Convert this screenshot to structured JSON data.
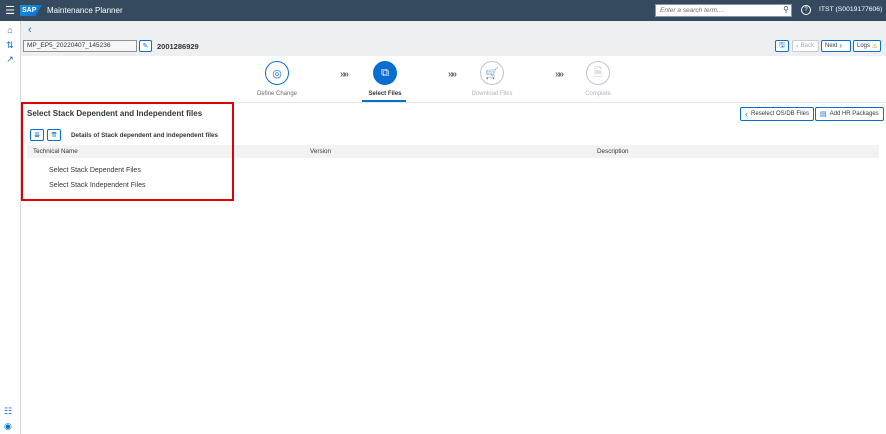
{
  "shell": {
    "logo": "SAP",
    "app_title": "Maintenance Planner",
    "search_placeholder": "Enter a search term....",
    "user": "ITST (S0019177606)",
    "icons": [
      "menu-icon",
      "search-icon",
      "help-icon"
    ]
  },
  "rail": {
    "icons": [
      "home-icon",
      "sort-icon",
      "external-link-icon",
      "library-icon",
      "location-icon"
    ]
  },
  "header": {
    "plan_name": "MP_EP5_20220407_145236",
    "plan_number": "2001286929",
    "buttons": {
      "back": "Back",
      "next": "Next",
      "logs": "Logs"
    }
  },
  "wizard": {
    "steps": [
      {
        "label": "Define Change",
        "state": "done",
        "icon": "target-icon"
      },
      {
        "label": "Select Files",
        "state": "active",
        "icon": "files-icon"
      },
      {
        "label": "Download Files",
        "state": "pending",
        "icon": "cart-icon"
      },
      {
        "label": "Complete",
        "state": "pending",
        "icon": "document-icon"
      }
    ]
  },
  "actions": {
    "reselect": "Reselect OS/DB Files",
    "add_hr": "Add HR Packages"
  },
  "section": {
    "title": "Select Stack Dependent and Independent files",
    "tree_title": "Details of Stack dependent and independent files",
    "columns": [
      "Technical Name",
      "Version",
      "Description"
    ],
    "rows": [
      "Select Stack Dependent Files",
      "Select Stack Independent Files"
    ]
  },
  "colors": {
    "shell": "#354a5f",
    "accent": "#0a6ed1",
    "highlight": "#e00000"
  }
}
